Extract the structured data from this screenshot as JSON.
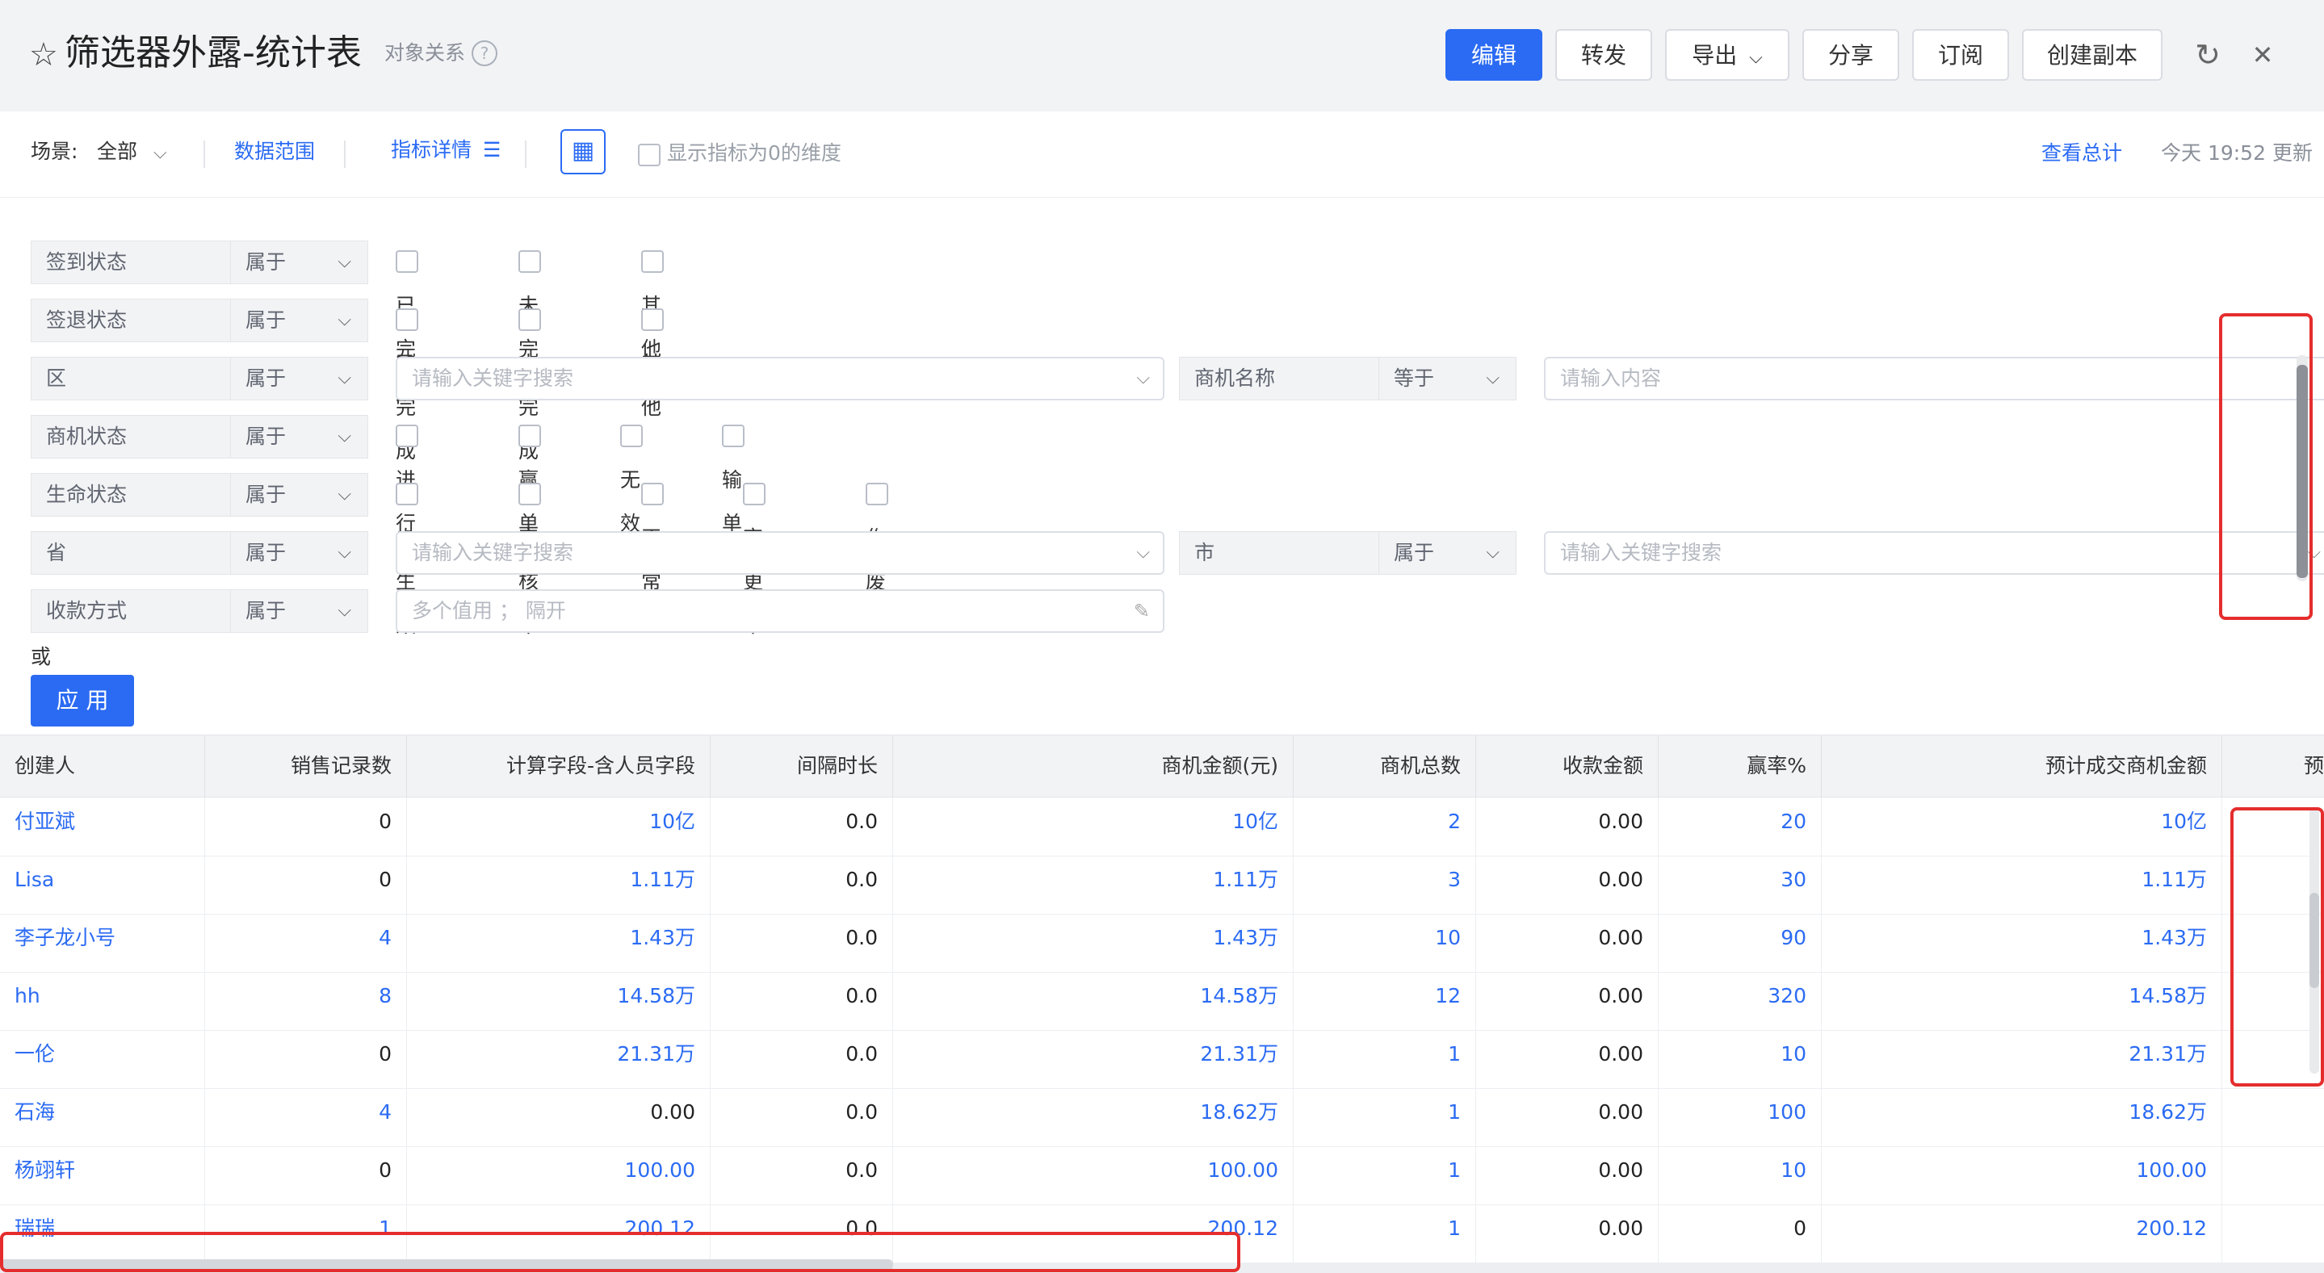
{
  "header": {
    "title": "筛选器外露-统计表",
    "subtitle": "对象关系",
    "help_icon": "?",
    "star_icon": "☆",
    "buttons": {
      "edit": "编辑",
      "forward": "转发",
      "export": "导出",
      "export_caret": "⌵",
      "share": "分享",
      "subscribe": "订阅",
      "copy": "创建副本"
    },
    "refresh_icon": "↻",
    "close_icon": "✕"
  },
  "toolbar": {
    "scene_label": "场景:",
    "scene_value": "全部",
    "scene_caret": "⌵",
    "data_range": "数据范围",
    "metric_detail": "指标详情",
    "metric_icon": "☰",
    "grid_icon": "▦",
    "show_zero": "显示指标为0的维度",
    "view_total": "查看总计",
    "update_time": "今天 19:52 更新"
  },
  "filters": {
    "rows": [
      {
        "label": "签到状态",
        "op": "属于",
        "options": [
          "已完成",
          "未完成",
          "其他"
        ]
      },
      {
        "label": "签退状态",
        "op": "属于",
        "options": [
          "已完成",
          "未完成",
          "其他"
        ]
      },
      {
        "label": "区",
        "op": "属于",
        "placeholder": "请输入关键字搜索",
        "label2": "商机名称",
        "op2": "等于",
        "placeholder2": "请输入内容"
      },
      {
        "label": "商机状态",
        "op": "属于",
        "options": [
          "进行中",
          "赢单",
          "无效",
          "输单"
        ]
      },
      {
        "label": "生命状态",
        "op": "属于",
        "options": [
          "未生效",
          "审核中",
          "正常",
          "变更中",
          "作废"
        ]
      },
      {
        "label": "省",
        "op": "属于",
        "placeholder": "请输入关键字搜索",
        "label2": "市",
        "op2": "属于",
        "placeholder2": "请输入关键字搜索"
      },
      {
        "label": "收款方式",
        "op": "属于",
        "placeholder": "多个值用 ； 隔开"
      }
    ],
    "chevron": "⌵",
    "pen_icon": "✎",
    "or_text": "或",
    "apply": "应 用"
  },
  "table": {
    "columns": [
      "创建人",
      "销售记录数",
      "计算字段-含人员字段",
      "间隔时长",
      "商机金额(元)",
      "商机总数",
      "收款金额",
      "赢率%",
      "预计成交商机金额",
      "预"
    ],
    "rows": [
      [
        "付亚斌",
        "0",
        "10亿",
        "0.0",
        "10亿",
        "2",
        "0.00",
        "20",
        "10亿"
      ],
      [
        "Lisa",
        "0",
        "1.11万",
        "0.0",
        "1.11万",
        "3",
        "0.00",
        "30",
        "1.11万"
      ],
      [
        "李子龙小号",
        "4",
        "1.43万",
        "0.0",
        "1.43万",
        "10",
        "0.00",
        "90",
        "1.43万"
      ],
      [
        "hh",
        "8",
        "14.58万",
        "0.0",
        "14.58万",
        "12",
        "0.00",
        "320",
        "14.58万"
      ],
      [
        "一伦",
        "0",
        "21.31万",
        "0.0",
        "21.31万",
        "1",
        "0.00",
        "10",
        "21.31万"
      ],
      [
        "石海",
        "4",
        "0.00",
        "0.0",
        "18.62万",
        "1",
        "0.00",
        "100",
        "18.62万"
      ],
      [
        "杨翊轩",
        "0",
        "100.00",
        "0.0",
        "100.00",
        "1",
        "0.00",
        "10",
        "100.00"
      ],
      [
        "瑞瑞",
        "1",
        "200.12",
        "0.0",
        "200.12",
        "1",
        "0.00",
        "0",
        "200.12"
      ]
    ]
  },
  "colors": {
    "accent": "#2b6bf3",
    "highlight": "#e52d2d"
  }
}
